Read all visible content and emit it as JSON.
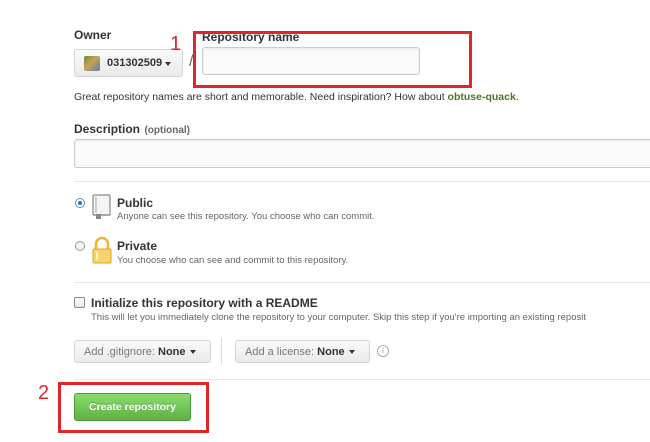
{
  "owner": {
    "label": "Owner",
    "value": "031302509"
  },
  "separator": "/",
  "repo_name": {
    "label": "Repository name",
    "value": "",
    "placeholder": ""
  },
  "hint": {
    "text": "Great repository names are short and memorable. Need inspiration? How about ",
    "suggestion": "obtuse-quack",
    "end": "."
  },
  "description": {
    "label": "Description",
    "optional": "(optional)",
    "value": ""
  },
  "visibility": {
    "public": {
      "title": "Public",
      "desc": "Anyone can see this repository. You choose who can commit.",
      "checked": true
    },
    "private": {
      "title": "Private",
      "desc": "You choose who can see and commit to this repository.",
      "checked": false
    }
  },
  "readme": {
    "title": "Initialize this repository with a README",
    "desc": "This will let you immediately clone the repository to your computer. Skip this step if you're importing an existing reposit",
    "checked": false
  },
  "gitignore": {
    "prefix": "Add .gitignore:",
    "value": "None"
  },
  "license": {
    "prefix": "Add a license:",
    "value": "None"
  },
  "info_glyph": "i",
  "create_button": "Create repository",
  "annotations": {
    "one": "1",
    "two": "2"
  },
  "colors": {
    "primary_button": "#60b044",
    "annotation": "#e0262d",
    "suggestion": "#4a7a1e"
  }
}
